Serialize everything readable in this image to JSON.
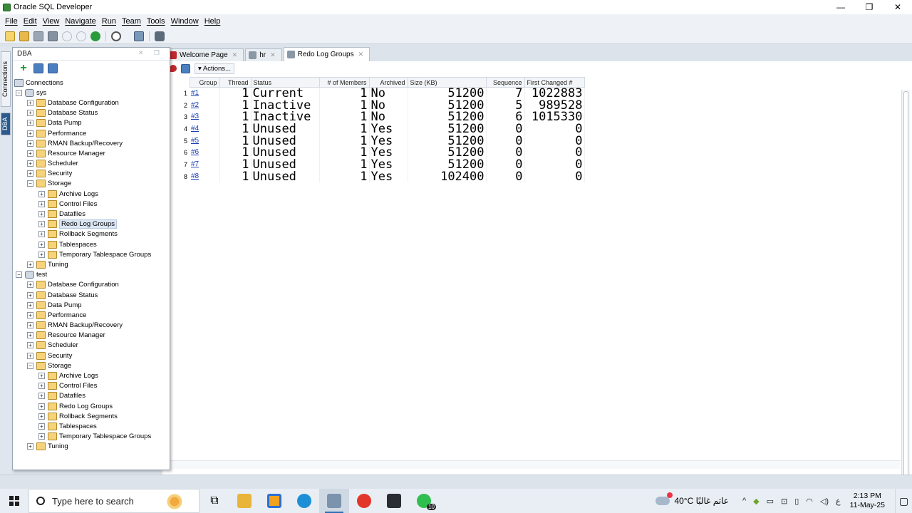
{
  "window": {
    "title": "Oracle SQL Developer",
    "buttons": [
      "—",
      "❐",
      "✕"
    ]
  },
  "menu": [
    "File",
    "Edit",
    "View",
    "Navigate",
    "Run",
    "Team",
    "Tools",
    "Window",
    "Help"
  ],
  "side_tabs": {
    "connections": "Connections",
    "dba": "DBA"
  },
  "dba_panel": {
    "title": "DBA",
    "tree": [
      {
        "label": "Connections",
        "level": 0,
        "icon": "conn",
        "exp": ""
      },
      {
        "label": "sys",
        "level": 1,
        "icon": "db",
        "exp": "−"
      },
      {
        "label": "Database Configuration",
        "level": 2,
        "icon": "folder",
        "exp": "+"
      },
      {
        "label": "Database Status",
        "level": 2,
        "icon": "folder",
        "exp": "+"
      },
      {
        "label": "Data Pump",
        "level": 2,
        "icon": "folder",
        "exp": "+"
      },
      {
        "label": "Performance",
        "level": 2,
        "icon": "folder",
        "exp": "+"
      },
      {
        "label": "RMAN Backup/Recovery",
        "level": 2,
        "icon": "folder",
        "exp": "+"
      },
      {
        "label": "Resource Manager",
        "level": 2,
        "icon": "folder",
        "exp": "+"
      },
      {
        "label": "Scheduler",
        "level": 2,
        "icon": "folder",
        "exp": "+"
      },
      {
        "label": "Security",
        "level": 2,
        "icon": "folder",
        "exp": "+"
      },
      {
        "label": "Storage",
        "level": 2,
        "icon": "folder",
        "exp": "−"
      },
      {
        "label": "Archive Logs",
        "level": 3,
        "icon": "folder",
        "exp": "+"
      },
      {
        "label": "Control Files",
        "level": 3,
        "icon": "folder",
        "exp": "+"
      },
      {
        "label": "Datafiles",
        "level": 3,
        "icon": "folder",
        "exp": "+"
      },
      {
        "label": "Redo Log Groups",
        "level": 3,
        "icon": "folder",
        "exp": "+",
        "selected": true
      },
      {
        "label": "Rollback Segments",
        "level": 3,
        "icon": "folder",
        "exp": "+"
      },
      {
        "label": "Tablespaces",
        "level": 3,
        "icon": "folder",
        "exp": "+"
      },
      {
        "label": "Temporary Tablespace Groups",
        "level": 3,
        "icon": "folder",
        "exp": "+"
      },
      {
        "label": "Tuning",
        "level": 2,
        "icon": "folder",
        "exp": "+"
      },
      {
        "label": "test",
        "level": 1,
        "icon": "db",
        "exp": "−"
      },
      {
        "label": "Database Configuration",
        "level": 2,
        "icon": "folder",
        "exp": "+"
      },
      {
        "label": "Database Status",
        "level": 2,
        "icon": "folder",
        "exp": "+"
      },
      {
        "label": "Data Pump",
        "level": 2,
        "icon": "folder",
        "exp": "+"
      },
      {
        "label": "Performance",
        "level": 2,
        "icon": "folder",
        "exp": "+"
      },
      {
        "label": "RMAN Backup/Recovery",
        "level": 2,
        "icon": "folder",
        "exp": "+"
      },
      {
        "label": "Resource Manager",
        "level": 2,
        "icon": "folder",
        "exp": "+"
      },
      {
        "label": "Scheduler",
        "level": 2,
        "icon": "folder",
        "exp": "+"
      },
      {
        "label": "Security",
        "level": 2,
        "icon": "folder",
        "exp": "+"
      },
      {
        "label": "Storage",
        "level": 2,
        "icon": "folder",
        "exp": "−"
      },
      {
        "label": "Archive Logs",
        "level": 3,
        "icon": "folder",
        "exp": "+"
      },
      {
        "label": "Control Files",
        "level": 3,
        "icon": "folder",
        "exp": "+"
      },
      {
        "label": "Datafiles",
        "level": 3,
        "icon": "folder",
        "exp": "+"
      },
      {
        "label": "Redo Log Groups",
        "level": 3,
        "icon": "folder",
        "exp": "+"
      },
      {
        "label": "Rollback Segments",
        "level": 3,
        "icon": "folder",
        "exp": "+"
      },
      {
        "label": "Tablespaces",
        "level": 3,
        "icon": "folder",
        "exp": "+"
      },
      {
        "label": "Temporary Tablespace Groups",
        "level": 3,
        "icon": "folder",
        "exp": "+"
      },
      {
        "label": "Tuning",
        "level": 2,
        "icon": "folder",
        "exp": "+"
      }
    ]
  },
  "editor_tabs": [
    {
      "label": "Welcome Page",
      "icon": "red",
      "active": false
    },
    {
      "label": "hr",
      "icon": "gray",
      "active": false
    },
    {
      "label": "Redo Log Groups",
      "icon": "gray",
      "active": true
    }
  ],
  "actions_label": "Actions...",
  "grid": {
    "columns": [
      "Group",
      "Thread",
      "Status",
      "# of Members",
      "Archived",
      "Size (KB)",
      "Sequence",
      "First Changed #"
    ],
    "rows": [
      {
        "n": "1",
        "group": "#1",
        "thread": "1",
        "status": "Current",
        "members": "1",
        "archived": "No",
        "size": "51200",
        "sequence": "7",
        "first_changed": "1022883"
      },
      {
        "n": "2",
        "group": "#2",
        "thread": "1",
        "status": "Inactive",
        "members": "1",
        "archived": "No",
        "size": "51200",
        "sequence": "5",
        "first_changed": "989528"
      },
      {
        "n": "3",
        "group": "#3",
        "thread": "1",
        "status": "Inactive",
        "members": "1",
        "archived": "No",
        "size": "51200",
        "sequence": "6",
        "first_changed": "1015330"
      },
      {
        "n": "4",
        "group": "#4",
        "thread": "1",
        "status": "Unused",
        "members": "1",
        "archived": "Yes",
        "size": "51200",
        "sequence": "0",
        "first_changed": "0"
      },
      {
        "n": "5",
        "group": "#5",
        "thread": "1",
        "status": "Unused",
        "members": "1",
        "archived": "Yes",
        "size": "51200",
        "sequence": "0",
        "first_changed": "0"
      },
      {
        "n": "6",
        "group": "#6",
        "thread": "1",
        "status": "Unused",
        "members": "1",
        "archived": "Yes",
        "size": "51200",
        "sequence": "0",
        "first_changed": "0"
      },
      {
        "n": "7",
        "group": "#7",
        "thread": "1",
        "status": "Unused",
        "members": "1",
        "archived": "Yes",
        "size": "51200",
        "sequence": "0",
        "first_changed": "0"
      },
      {
        "n": "8",
        "group": "#8",
        "thread": "1",
        "status": "Unused",
        "members": "1",
        "archived": "Yes",
        "size": "102400",
        "sequence": "0",
        "first_changed": "0"
      }
    ]
  },
  "taskbar": {
    "search_placeholder": "Type here to search",
    "weather": "40°C  عاتم غالبًا",
    "lang": "ع",
    "time": "2:13 PM",
    "date": "11-May-25",
    "badge": "10"
  }
}
